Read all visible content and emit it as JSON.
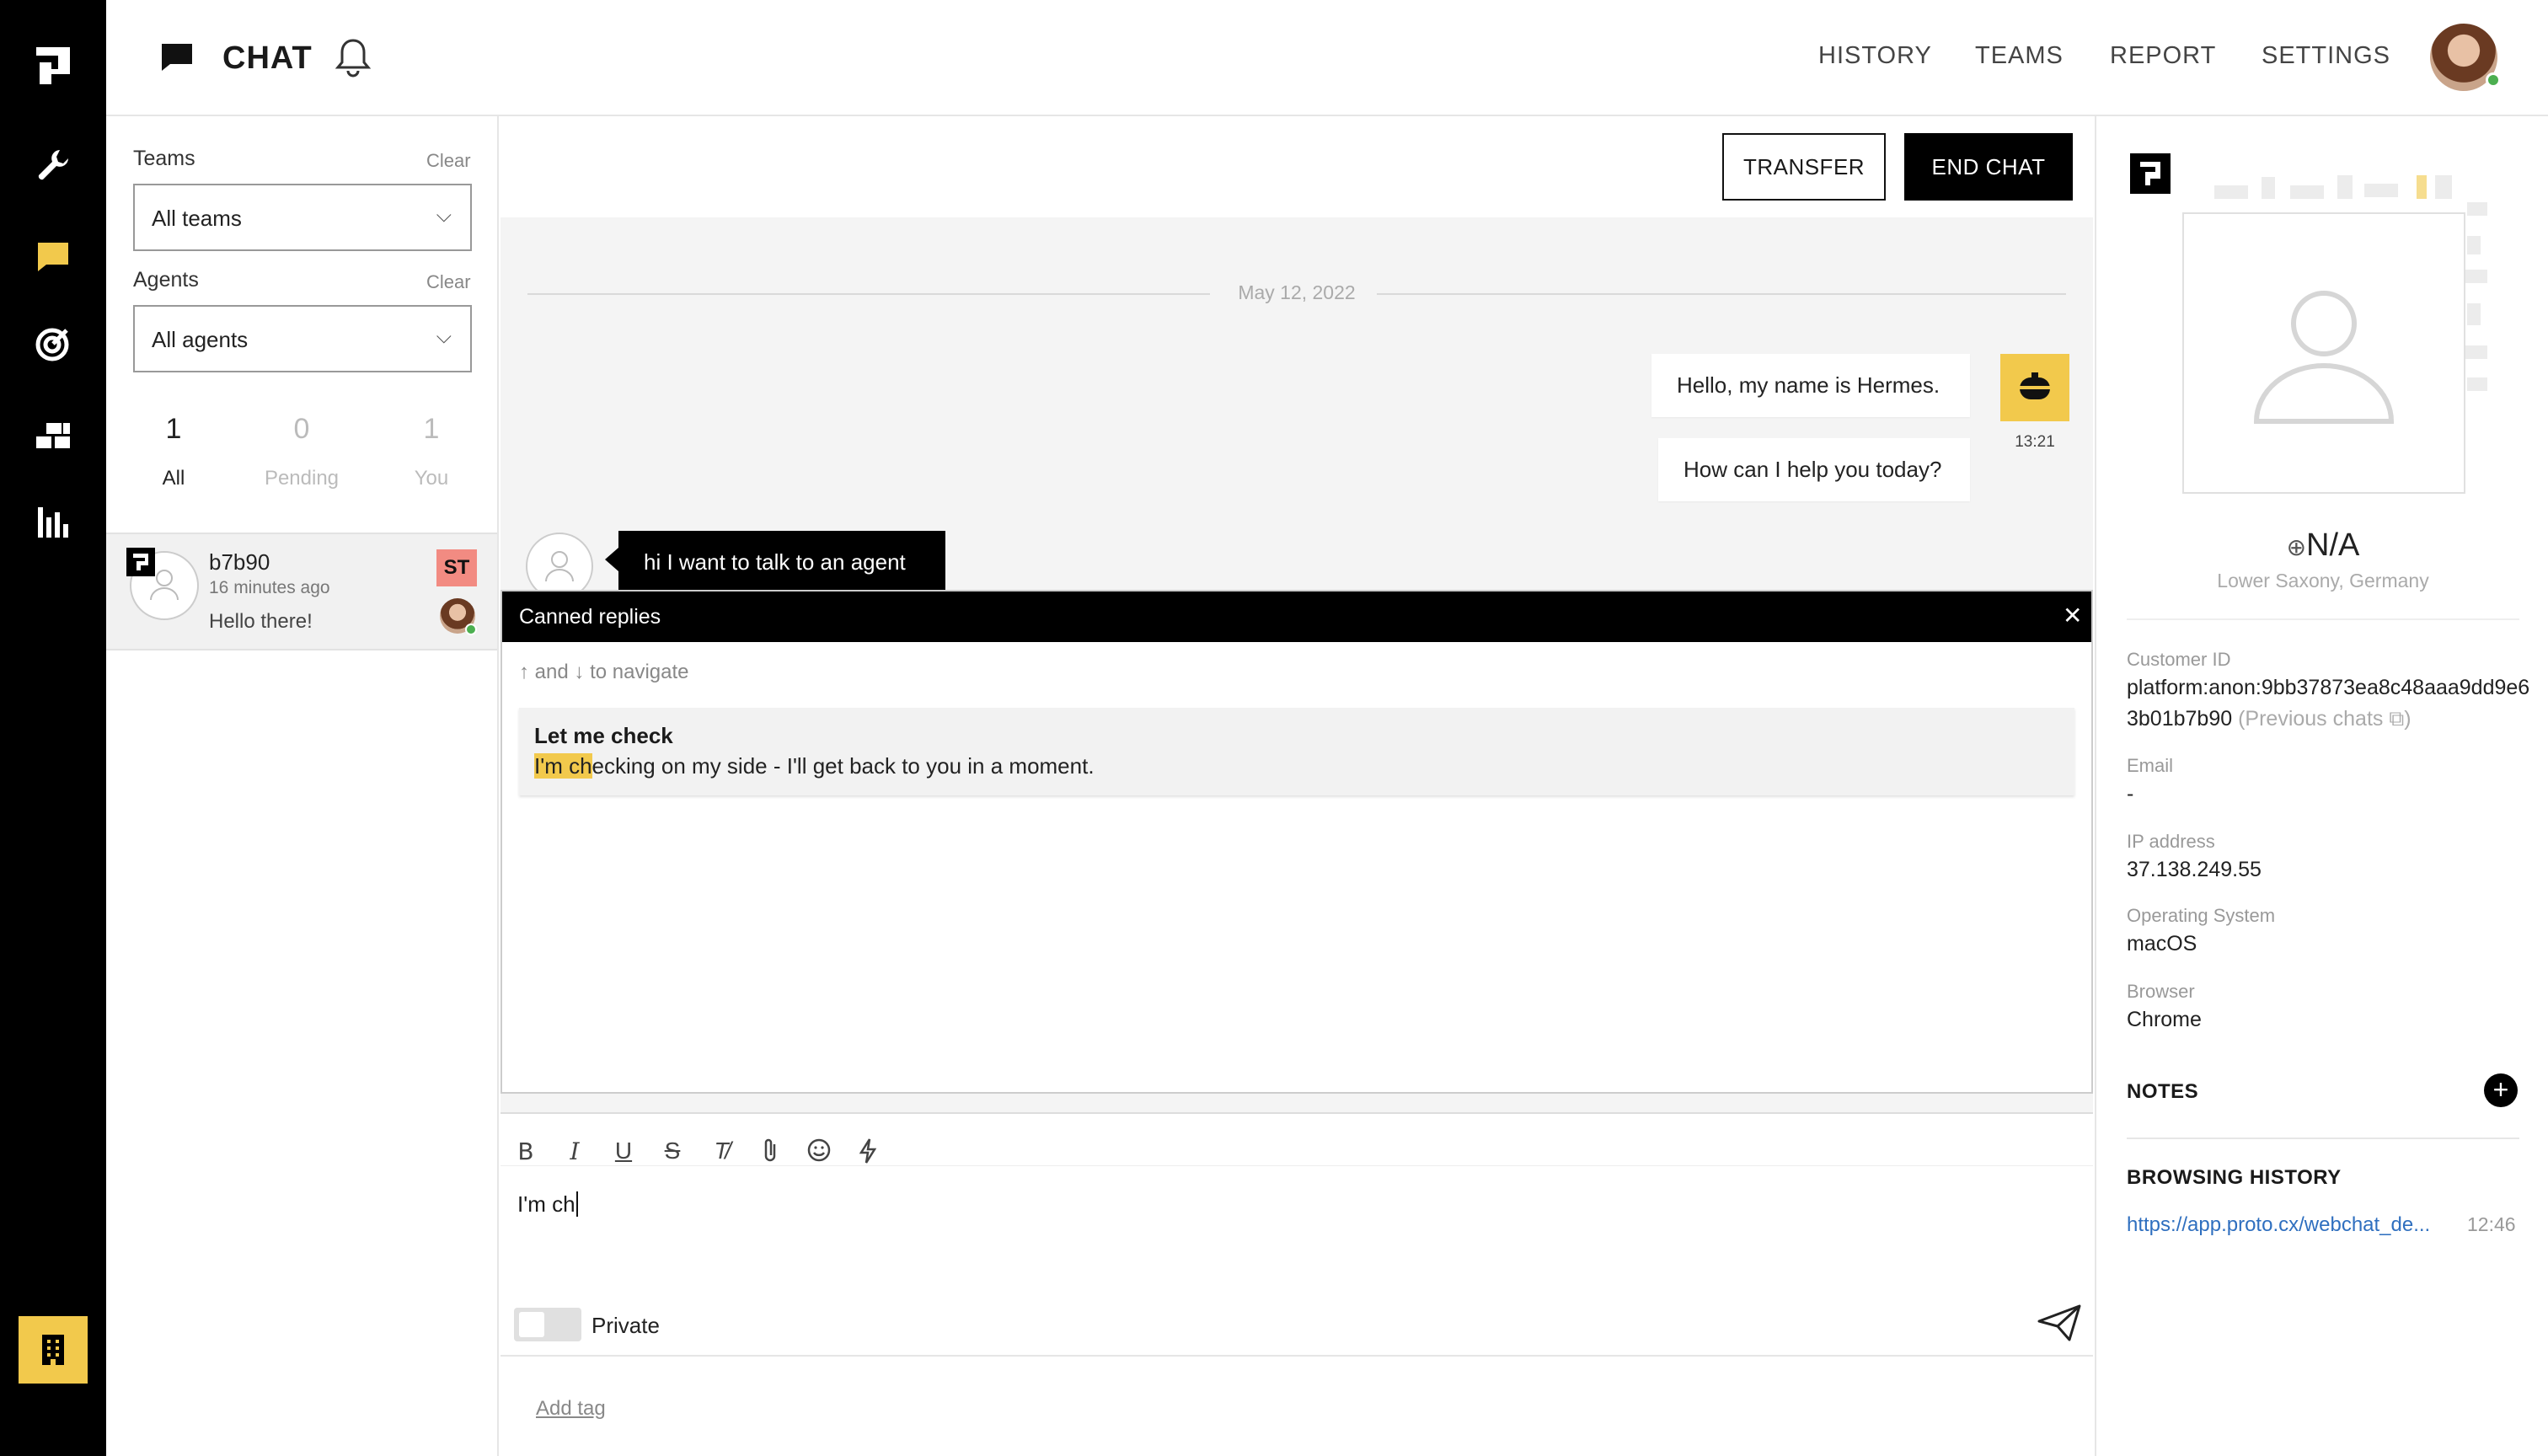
{
  "app": {
    "section_title": "CHAT",
    "nav": [
      "HISTORY",
      "TEAMS",
      "REPORT",
      "SETTINGS"
    ]
  },
  "rail": {
    "icons": [
      "logo-icon",
      "wrench-icon",
      "chat-icon",
      "target-icon",
      "bricks-icon",
      "bar-chart-icon"
    ],
    "active_icon": "chat-icon",
    "bottom_icon": "building-icon",
    "accent": "#f2c94c"
  },
  "filters": {
    "teams_label": "Teams",
    "teams_clear": "Clear",
    "teams_value": "All teams",
    "agents_label": "Agents",
    "agents_clear": "Clear",
    "agents_value": "All agents"
  },
  "counts": [
    {
      "value": "1",
      "label": "All"
    },
    {
      "value": "0",
      "label": "Pending"
    },
    {
      "value": "1",
      "label": "You"
    }
  ],
  "conversation": {
    "name": "b7b90",
    "time": "16 minutes ago",
    "preview": "Hello there!",
    "badge": "ST",
    "badge_color": "#f28b82"
  },
  "chat": {
    "transfer_label": "TRANSFER",
    "end_label": "END CHAT",
    "date": "May 12, 2022",
    "bot_messages": [
      "Hello, my name is Hermes.",
      "How can I help you today?"
    ],
    "bot_time": "13:21",
    "user_message": "hi I want to talk to an agent"
  },
  "canned": {
    "title": "Canned replies",
    "hint_and": "and",
    "hint_nav": "to navigate",
    "item_title": "Let me check",
    "item_highlight": "I'm ch",
    "item_rest": "ecking on my side - I'll get back to you in a moment.",
    "highlight_color": "#f2c94c"
  },
  "editor": {
    "text": "I'm ch",
    "private_label": "Private",
    "add_tag": "Add tag",
    "tools": [
      "bold-icon",
      "italic-icon",
      "underline-icon",
      "strikethrough-icon",
      "clear-format-icon",
      "attachment-icon",
      "emoji-icon",
      "lightning-icon"
    ]
  },
  "customer": {
    "name": "N/A",
    "location": "Lower Saxony, Germany",
    "id_label": "Customer ID",
    "id_value": "platform:anon:9bb37873ea8c48aaa9dd9e63b01b7b90",
    "previous_chats": "(Previous chats",
    "email_label": "Email",
    "email_value": "-",
    "ip_label": "IP address",
    "ip_value": "37.138.249.55",
    "os_label": "Operating System",
    "os_value": "macOS",
    "browser_label": "Browser",
    "browser_value": "Chrome",
    "notes_label": "NOTES",
    "history_label": "BROWSING HISTORY",
    "history_url": "https://app.proto.cx/webchat_de...",
    "history_time": "12:46"
  }
}
